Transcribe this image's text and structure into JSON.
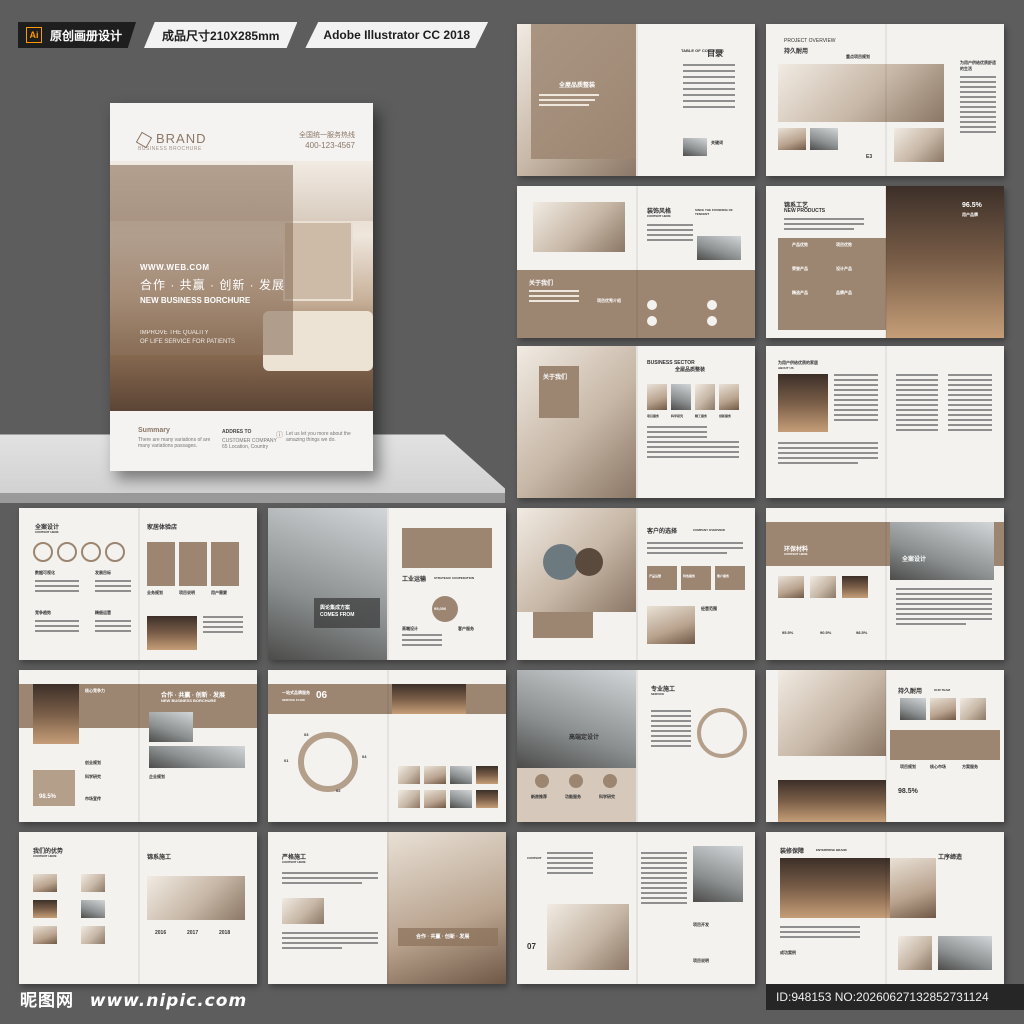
{
  "banner": {
    "ai_icon": "Ai",
    "tag1": "原创画册设计",
    "tag2": "成品尺寸210X285mm",
    "tag3": "Adobe Illustrator CC 2018"
  },
  "cover": {
    "brand": "BRAND",
    "brand_sub": "BUSINESS BROCHURE",
    "hotline_label": "全国统一服务热线",
    "hotline": "400-123-4567",
    "web": "WWW.WEB.COM",
    "slogan_cn": "合作 · 共赢 · 创新 · 发展",
    "slogan_en": "NEW BUSINESS BORCHURE",
    "tagline_1": "IMPROVE THE QUALITY",
    "tagline_2": "OF LIFE SERVICE FOR PATIENTS",
    "summary_title": "Summary",
    "summary_text": "There are many variations of are many variations passages.",
    "address_title": "ADDRES TO",
    "address_text": "CUSTOMER COMPANY 65 Location, Country",
    "let_text": "Let us let you more about the amazing things we do."
  },
  "spreads": {
    "s1": {
      "heading": "全屋品质整装",
      "toc_label": "TABLE OF CONTENTS",
      "toc_title": "目录",
      "photo_label": "关键词"
    },
    "s2": {
      "heading": "PROJECT OVERVIEW",
      "heading_cn": "持久耐用",
      "sub": "重点项目规划",
      "right_title": "为用户供给优质舒适的生活",
      "code": "E3"
    },
    "s3": {
      "heading": "装饰风格",
      "heading_sub": "CONTENT HERE",
      "tag": "SINCE THE FOUNDING OF TENCENT",
      "left_title": "关于我们",
      "icon_title": "项目优秀介绍"
    },
    "s4": {
      "heading": "锦系工艺",
      "heading_sub": "NEW PRODUCTS",
      "percent": "96.5%",
      "side": "用户品牌",
      "items": [
        "产品优势",
        "项目优势",
        "荣誉产品",
        "设计产品",
        "精选产品",
        "品牌产品"
      ]
    },
    "s5": {
      "heading": "关于我们",
      "right_title": "BUSINESS SECTOR",
      "right_title_cn": "全屋品质整装",
      "items": [
        "项目服务",
        "科学研究",
        "精工服务",
        "创新服务"
      ]
    },
    "s6": {
      "heading": "为用户供给优质的家居",
      "heading_sub": "ABOUT US"
    },
    "s7": {
      "heading": "全案设计",
      "heading_sub": "CONTENT HERE",
      "right_title": "家居体验店",
      "items": [
        "数据可视化",
        "发展目标",
        "竞争趋势",
        "精细运营"
      ],
      "cols": [
        "业务规划",
        "项目说明",
        "用户需要"
      ]
    },
    "s8": {
      "overlay_cn": "舆论集成方案",
      "overlay_en": "COMES FROM",
      "right_title": "工业运输",
      "right_sub": "STRATEGIC COOPERATION",
      "stat": "95,000",
      "items": [
        "高端设计",
        "客户服务"
      ]
    },
    "s9": {
      "heading": "客户的选择",
      "heading_sub": "COMPANY OVERVIEW",
      "items": [
        "产品运营",
        "特色服务",
        "客户服务"
      ],
      "extra": "经营范围"
    },
    "s10": {
      "heading": "环保材料",
      "heading_sub": "CONTENT HERE",
      "right_heading": "全案设计",
      "stats": [
        "95.5%",
        "90.5%",
        "98.5%"
      ]
    },
    "s11": {
      "heading": "核心竞争力",
      "right_title": "合作 · 共赢 · 创新 · 发展",
      "right_sub": "NEW BUSINESS BORCHURE",
      "badge": "98.5%",
      "items": [
        "创业规划",
        "科学研究",
        "市场宣传",
        "企业规划"
      ]
    },
    "s12": {
      "heading": "一站式品牌服务",
      "heading_sub": "SERVICE FLOW",
      "num": "06",
      "steps": [
        "01",
        "02",
        "03",
        "04"
      ]
    },
    "s13": {
      "heading": "高端定设计",
      "items": [
        "新房推荐",
        "功能服务",
        "科学研究"
      ],
      "right_title": "专业施工",
      "right_sub": "SERVICE"
    },
    "s14": {
      "heading": "持久耐用",
      "heading_sub": "OUR TEAM",
      "percent": "98.5%",
      "items": [
        "项目规划",
        "核心市场",
        "方案服务"
      ]
    },
    "s15": {
      "heading": "我们的优势",
      "heading_sub": "CONTENT HERE",
      "right_title": "锦系施工",
      "years": [
        "2016",
        "2017",
        "2018"
      ]
    },
    "s16": {
      "heading": "严格施工",
      "heading_sub": "CONTENT HERE",
      "caption": "合作 · 共赢 · 创新 · 发展"
    },
    "s17": {
      "num": "07",
      "side": "CONTENT",
      "items": [
        "项目开发",
        "项目说明"
      ]
    },
    "s18": {
      "heading": "装修保障",
      "heading_sub": "ENTERPRISE BRAND",
      "right_title": "工序缔造",
      "bottom": "成功案例"
    }
  },
  "footer": {
    "site_cn": "昵图网",
    "site_url": "www.nipic.com",
    "id_text": "ID:948153 NO:20260627132852731124"
  }
}
